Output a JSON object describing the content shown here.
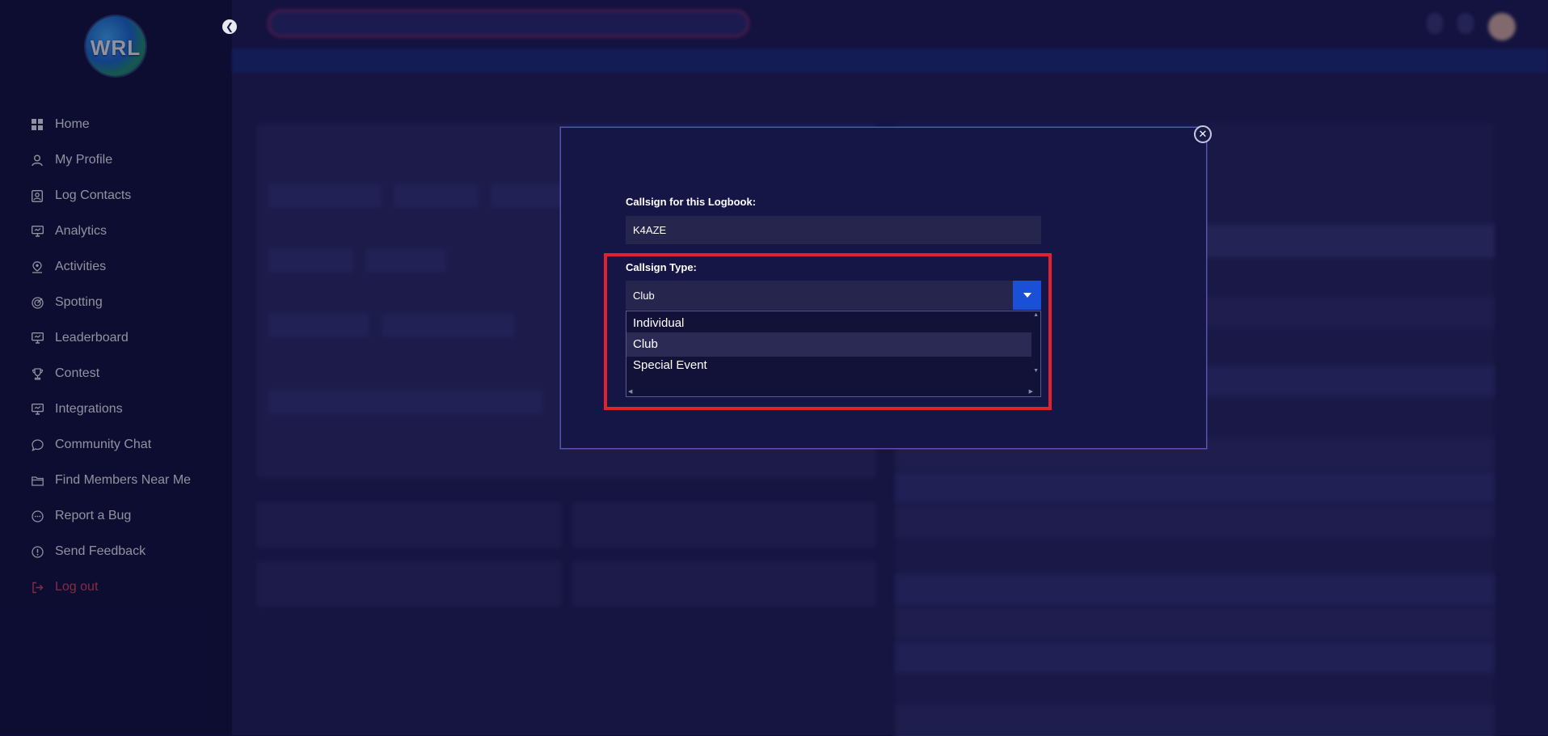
{
  "sidebar": {
    "logo_text": "WRL",
    "items": [
      {
        "label": "Home",
        "icon": "grid-icon"
      },
      {
        "label": "My Profile",
        "icon": "user-icon"
      },
      {
        "label": "Log Contacts",
        "icon": "contact-card-icon"
      },
      {
        "label": "Analytics",
        "icon": "monitor-icon"
      },
      {
        "label": "Activities",
        "icon": "person-pin-icon"
      },
      {
        "label": "Spotting",
        "icon": "radar-icon"
      },
      {
        "label": "Leaderboard",
        "icon": "monitor-icon"
      },
      {
        "label": "Contest",
        "icon": "trophy-icon"
      },
      {
        "label": "Integrations",
        "icon": "monitor-icon"
      },
      {
        "label": "Community Chat",
        "icon": "chat-icon"
      },
      {
        "label": "Find Members Near Me",
        "icon": "folder-icon"
      },
      {
        "label": "Report a Bug",
        "icon": "bug-chat-icon"
      },
      {
        "label": "Send Feedback",
        "icon": "alert-circle-icon"
      },
      {
        "label": "Log out",
        "icon": "logout-icon"
      }
    ]
  },
  "modal": {
    "callsign_label": "Callsign for this Logbook:",
    "callsign_value": "K4AZE",
    "type_label": "Callsign Type:",
    "type_selected": "Club",
    "type_options": [
      "Individual",
      "Club",
      "Special Event"
    ]
  },
  "colors": {
    "accent_blue": "#1a4fd8",
    "highlight_red": "#e0222e",
    "logout_red": "#e84a5a",
    "sidebar_bg": "#10103a"
  }
}
